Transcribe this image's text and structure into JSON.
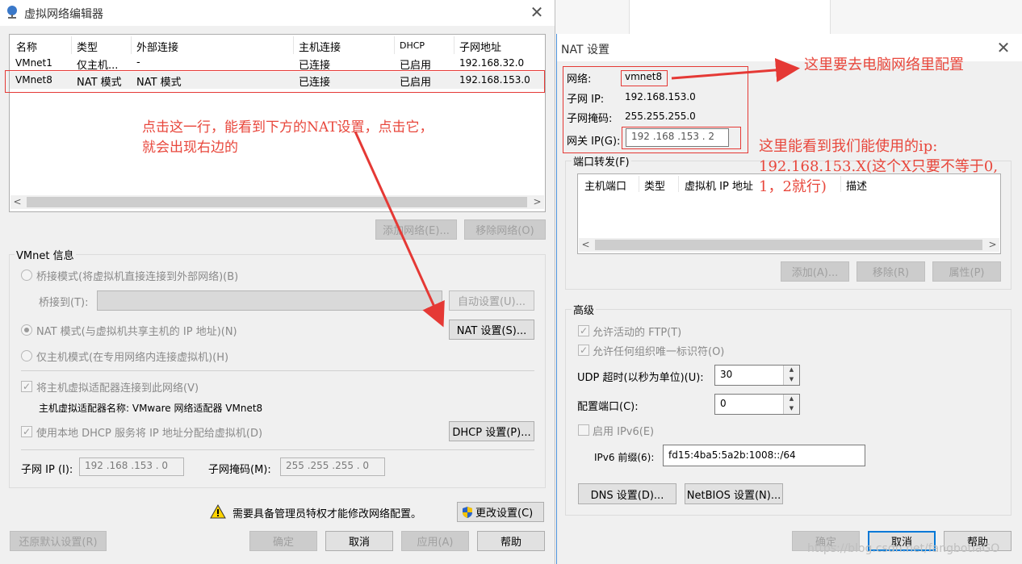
{
  "left_dialog": {
    "title": "虚拟网络编辑器",
    "columns": [
      "名称",
      "类型",
      "外部连接",
      "主机连接",
      "DHCP",
      "子网地址"
    ],
    "rows": [
      [
        "VMnet1",
        "仅主机...",
        "-",
        "已连接",
        "已启用",
        "192.168.32.0"
      ],
      [
        "VMnet8",
        "NAT 模式",
        "NAT 模式",
        "已连接",
        "已启用",
        "192.168.153.0"
      ]
    ],
    "add_network_button": "添加网络(E)...",
    "remove_network_button": "移除网络(O)",
    "vmnet_info_label": "VMnet 信息",
    "bridge_mode": "桥接模式(将虚拟机直接连接到外部网络)(B)",
    "bridge_to_label": "桥接到(T):",
    "auto_settings_button": "自动设置(U)...",
    "nat_mode": "NAT 模式(与虚拟机共享主机的 IP 地址)(N)",
    "nat_settings_button": "NAT 设置(S)...",
    "host_only_mode": "仅主机模式(在专用网络内连接虚拟机)(H)",
    "connect_adapter": "将主机虚拟适配器连接到此网络(V)",
    "adapter_name": "主机虚拟适配器名称: VMware 网络适配器 VMnet8",
    "use_dhcp": "使用本地 DHCP 服务将 IP 地址分配给虚拟机(D)",
    "dhcp_settings_button": "DHCP 设置(P)...",
    "subnet_ip_label": "子网 IP (I):",
    "subnet_ip_value": "192 .168 .153 .  0",
    "subnet_mask_label": "子网掩码(M):",
    "subnet_mask_value": "255 .255 .255 .  0",
    "admin_warning": "需要具备管理员特权才能修改网络配置。",
    "change_settings_button": "更改设置(C)",
    "restore_defaults_button": "还原默认设置(R)",
    "ok_button": "确定",
    "cancel_button": "取消",
    "apply_button": "应用(A)",
    "help_button": "帮助"
  },
  "right_dialog": {
    "title": "NAT 设置",
    "network_label": "网络:",
    "network_value": "vmnet8",
    "subnet_ip_label": "子网 IP:",
    "subnet_ip_value": "192.168.153.0",
    "subnet_mask_label": "子网掩码:",
    "subnet_mask_value": "255.255.255.0",
    "gateway_label": "网关 IP(G):",
    "gateway_value": "192 .168 .153 .  2",
    "port_forwarding_label": "端口转发(F)",
    "pf_columns": [
      "主机端口",
      "类型",
      "虚拟机 IP 地址",
      "描述"
    ],
    "add_button": "添加(A)...",
    "remove_button": "移除(R)",
    "properties_button": "属性(P)",
    "advanced_label": "高级",
    "allow_ftp": "允许活动的 FTP(T)",
    "allow_uuid": "允许任何组织唯一标识符(O)",
    "udp_timeout_label": "UDP 超时(以秒为单位)(U):",
    "udp_timeout_value": "30",
    "config_port_label": "配置端口(C):",
    "config_port_value": "0",
    "enable_ipv6": "启用 IPv6(E)",
    "ipv6_prefix_label": "IPv6 前缀(6):",
    "ipv6_prefix_value": "fd15:4ba5:5a2b:1008::/64",
    "dns_button": "DNS 设置(D)...",
    "netbios_button": "NetBIOS 设置(N)...",
    "ok_button": "确定",
    "cancel_button": "取消",
    "help_button": "帮助"
  },
  "annotations": {
    "click_row_line1": "点击这一行，能看到下方的NAT设置，点击它，",
    "click_row_line2": "就会出现右边的",
    "configure_network": "这里要去电脑网络里配置",
    "usable_ip_line1": "这里能看到我们能使用的ip:",
    "usable_ip_line2": "192.168.153.X(这个X只要不等于0,",
    "usable_ip_line3": "1，2就行)"
  },
  "watermark": "https://blog.csdn.net/fangbotiaGO",
  "colors": {
    "annotation_red": "#e53935",
    "focus_blue": "#0078d7"
  }
}
